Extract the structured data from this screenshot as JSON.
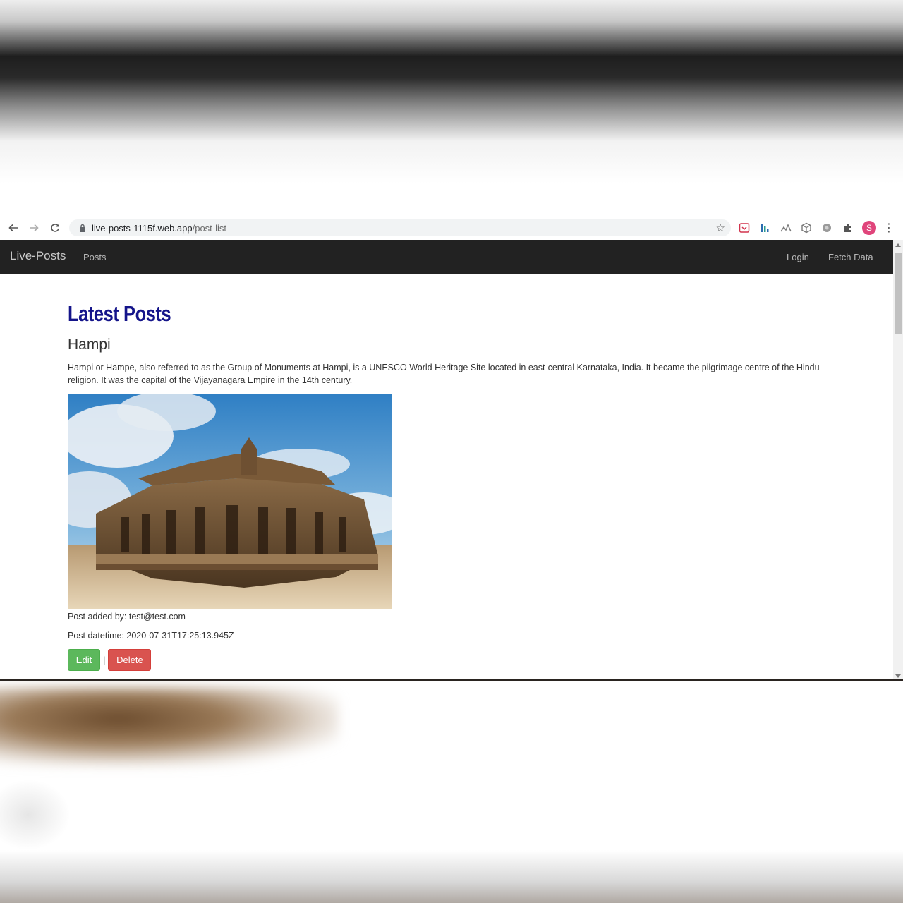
{
  "browser": {
    "url_host": "live-posts-1115f.web.app",
    "url_path": "/post-list",
    "profile_initial": "S"
  },
  "navbar": {
    "brand": "Live-Posts",
    "left_links": [
      "Posts"
    ],
    "right_links": [
      "Login",
      "Fetch Data"
    ],
    "background_color": "#222222"
  },
  "page": {
    "heading": "Latest Posts",
    "heading_color": "#14148a"
  },
  "posts": [
    {
      "title": "Hampi",
      "description": "Hampi or Hampe, also referred to as the Group of Monuments at Hampi, is a UNESCO World Heritage Site located in east-central Karnataka, India. It became the pilgrimage centre of the Hindu religion. It was the capital of the Vijayanagara Empire in the 14th century.",
      "added_by": "Post added by: test@test.com",
      "datetime": "Post datetime: 2020-07-31T17:25:13.945Z",
      "edit_label": "Edit",
      "separator": "|",
      "delete_label": "Delete"
    }
  ],
  "colors": {
    "edit": "#5cb85c",
    "delete": "#d9534f"
  }
}
